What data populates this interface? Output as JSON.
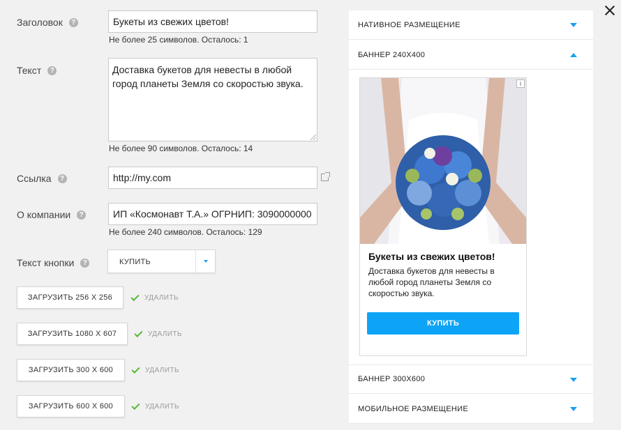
{
  "form": {
    "headline": {
      "label": "Заголовок",
      "value": "Букеты из свежих цветов!",
      "hint": "Не более 25 символов. Осталось: 1"
    },
    "text": {
      "label": "Текст",
      "value": "Доставка букетов для невесты в любой город планеты Земля со скоростью звука.",
      "hint": "Не более 90 символов. Осталось: 14"
    },
    "link": {
      "label": "Ссылка",
      "value": "http://my.com"
    },
    "company": {
      "label": "О компании",
      "value": "ИП «Космонавт Т.А.» ОГРНИП: 3090000000",
      "hint": "Не более 240 символов. Осталось: 129"
    },
    "button_text": {
      "label": "Текст кнопки",
      "selected": "КУПИТЬ"
    },
    "help_glyph": "?",
    "uploads": [
      {
        "label": "ЗАГРУЗИТЬ 256 Х 256",
        "delete": "УДАЛИТЬ"
      },
      {
        "label": "ЗАГРУЗИТЬ 1080 Х 607",
        "delete": "УДАЛИТЬ"
      },
      {
        "label": "ЗАГРУЗИТЬ 300 Х 600",
        "delete": "УДАЛИТЬ"
      },
      {
        "label": "ЗАГРУЗИТЬ 600 Х 600",
        "delete": "УДАЛИТЬ"
      }
    ]
  },
  "preview": {
    "sections": [
      {
        "label": "НАТИВНОЕ РАЗМЕЩЕНИЕ",
        "expanded": false
      },
      {
        "label": "БАННЕР 240Х400",
        "expanded": true
      },
      {
        "label": "БАННЕР 300Х600",
        "expanded": false
      },
      {
        "label": "МОБИЛЬНОЕ РАЗМЕЩЕНИЕ",
        "expanded": false
      }
    ],
    "banner": {
      "info_glyph": "i",
      "title": "Букеты из свежих цветов!",
      "text": "Доставка букетов для невесты в любой город планеты Земля со скоростью звука.",
      "button": "КУПИТЬ"
    }
  },
  "colors": {
    "accent": "#1aa0f0",
    "cta": "#0da4f7",
    "check": "#55b733",
    "background": "#f1f1f1"
  }
}
